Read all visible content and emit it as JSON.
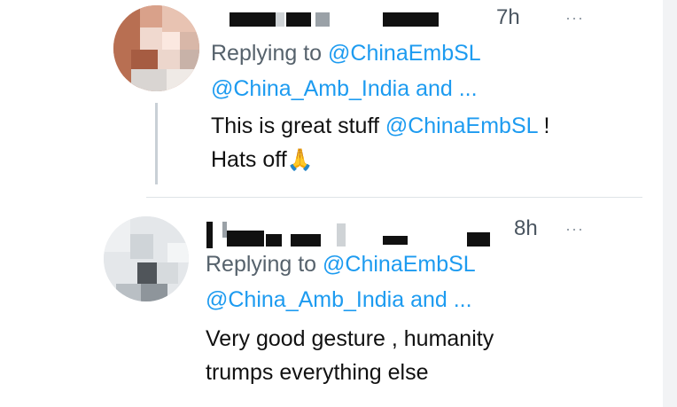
{
  "tweets": [
    {
      "time": "7h",
      "more": "···",
      "replying_prefix": "Replying to ",
      "replying_mention": "@ChinaEmbSL",
      "replying_line2": "@China_Amb_India and ...",
      "body_line1_text": "This is great stuff ",
      "body_line1_mention": "@ChinaEmbSL",
      "body_line1_suffix": " !",
      "body_line2": "Hats off",
      "body_emoji": "🙏"
    },
    {
      "time": "8h",
      "more": "···",
      "replying_prefix": "Replying to ",
      "replying_mention": "@ChinaEmbSL",
      "replying_line2": "@China_Amb_India and ...",
      "body_line1": "Very good gesture , humanity",
      "body_line2": "trumps everything else"
    }
  ],
  "colors": {
    "mention": "#1d9bf0",
    "secondary_text": "#56626c",
    "divider": "#dfe3e7"
  }
}
